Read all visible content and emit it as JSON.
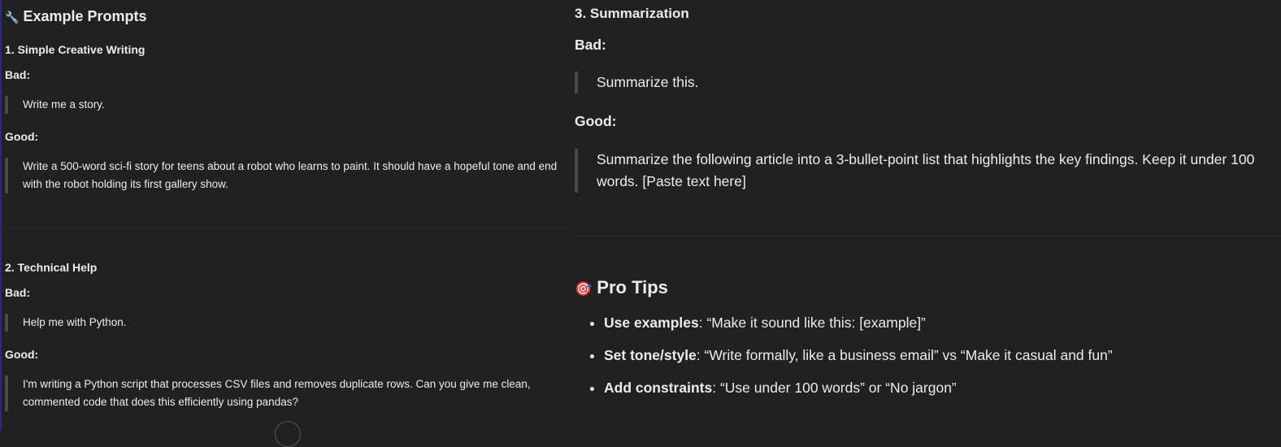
{
  "left": {
    "title_icon": "🔧",
    "title": "Example Prompts",
    "sections": [
      {
        "heading": "1. Simple Creative Writing",
        "bad_label": "Bad:",
        "bad": "Write me a story.",
        "good_label": "Good:",
        "good": "Write a 500-word sci-fi story for teens about a robot who learns to paint. It should have a hopeful tone and end with the robot holding its first gallery show."
      },
      {
        "heading": "2. Technical Help",
        "bad_label": "Bad:",
        "bad": "Help me with Python.",
        "good_label": "Good:",
        "good": "I'm writing a Python script that processes CSV files and removes duplicate rows. Can you give me clean, commented code that does this efficiently using pandas?"
      }
    ]
  },
  "right": {
    "section": {
      "heading": "3. Summarization",
      "bad_label": "Bad:",
      "bad": "Summarize this.",
      "good_label": "Good:",
      "good": "Summarize the following article into a 3-bullet-point list that highlights the key findings. Keep it under 100 words. [Paste text here]"
    },
    "tips_icon": "🎯",
    "tips_title": "Pro Tips",
    "tips": [
      {
        "bold": "Use examples",
        "text": ": “Make it sound like this: [example]”"
      },
      {
        "bold": "Set tone/style",
        "text": ": “Write formally, like a business email” vs “Make it casual and fun”"
      },
      {
        "bold": "Add constraints",
        "text": ": “Use under 100 words” or “No jargon”"
      }
    ]
  }
}
